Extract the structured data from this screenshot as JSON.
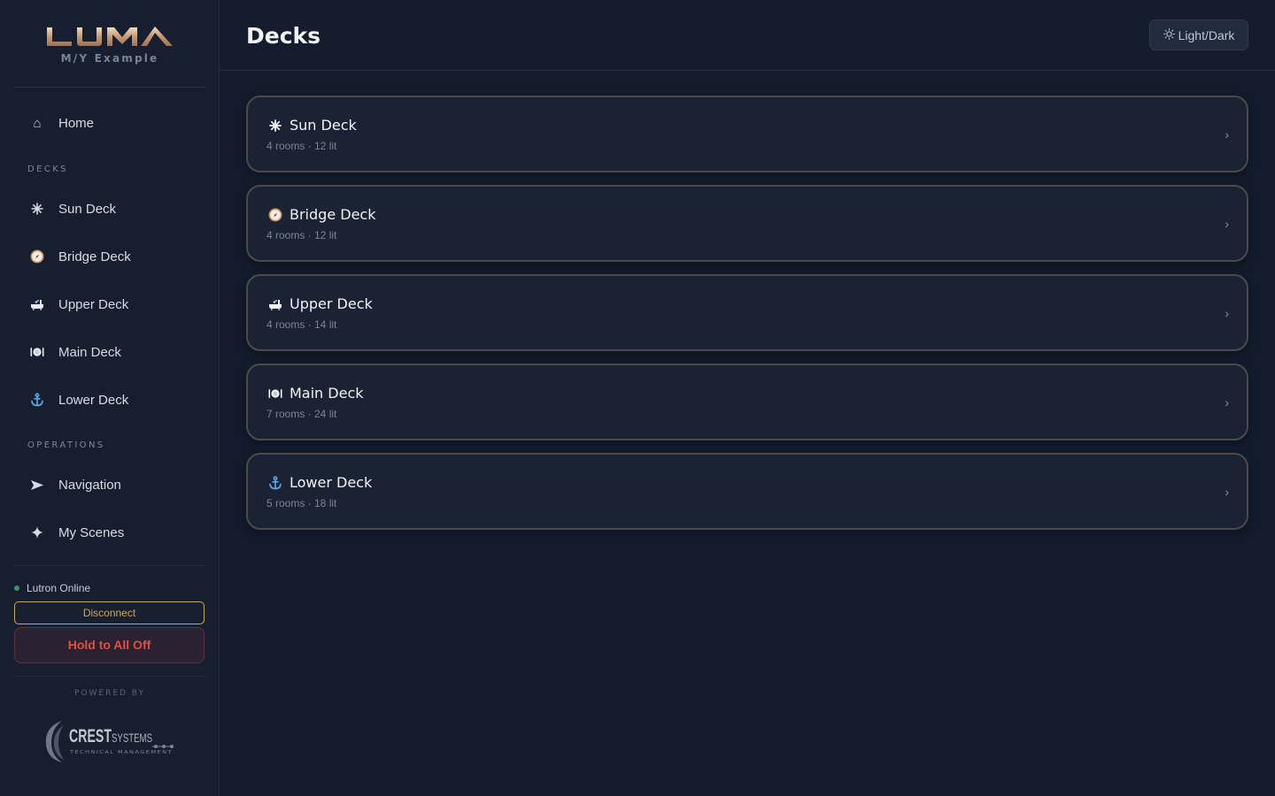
{
  "brand": {
    "logo_text": "LUMA",
    "subtitle": "M/Y Example"
  },
  "sidebar": {
    "home": {
      "label": "Home",
      "icon": "home-icon"
    },
    "decks_section": "DECKS",
    "decks": [
      {
        "label": "Sun Deck",
        "icon": "sun-icon"
      },
      {
        "label": "Bridge Deck",
        "icon": "compass-icon"
      },
      {
        "label": "Upper Deck",
        "icon": "bathtub-icon"
      },
      {
        "label": "Main Deck",
        "icon": "dining-icon"
      },
      {
        "label": "Lower Deck",
        "icon": "anchor-icon"
      }
    ],
    "operations_section": "OPERATIONS",
    "operations": [
      {
        "label": "Navigation",
        "icon": "navigation-arrow-icon"
      },
      {
        "label": "My Scenes",
        "icon": "sparkle-icon"
      }
    ],
    "status_label": "Lutron Online",
    "status_color": "#3f8f6a",
    "disconnect_label": "Disconnect",
    "all_off_label": "Hold to All Off",
    "powered_by": "POWERED BY",
    "partner_logo_text": "CREST SYSTEMS",
    "partner_tagline": "TECHNICAL MANAGEMENT"
  },
  "header": {
    "title": "Decks",
    "theme_toggle_label": "Light/Dark"
  },
  "deck_cards": [
    {
      "title": "Sun Deck",
      "meta": "4 rooms · 12 lit",
      "icon": "sun-icon"
    },
    {
      "title": "Bridge Deck",
      "meta": "4 rooms · 12 lit",
      "icon": "compass-icon"
    },
    {
      "title": "Upper Deck",
      "meta": "4 rooms · 14 lit",
      "icon": "bathtub-icon"
    },
    {
      "title": "Main Deck",
      "meta": "7 rooms · 24 lit",
      "icon": "dining-icon"
    },
    {
      "title": "Lower Deck",
      "meta": "5 rooms · 18 lit",
      "icon": "anchor-icon"
    }
  ],
  "colors": {
    "accent_gold": "#c9a75e",
    "danger": "#e0513f",
    "background": "#141b2c"
  }
}
